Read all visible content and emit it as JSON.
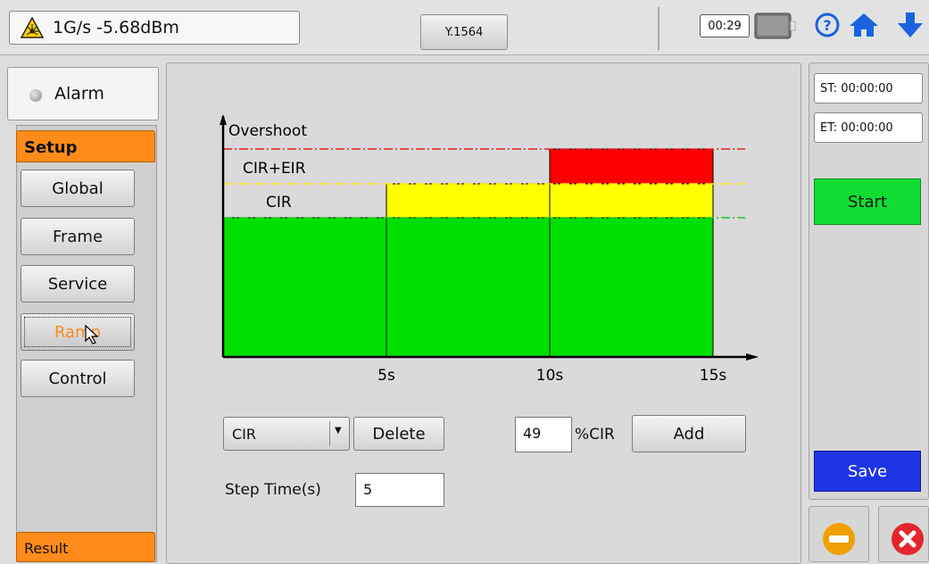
{
  "status": {
    "signal_text": "1G/s -5.68dBm",
    "mode_label": "Y.1564",
    "timer": "00:29"
  },
  "sidebar": {
    "alarm_label": "Alarm",
    "section_header": "Setup",
    "items": [
      {
        "label": "Global"
      },
      {
        "label": "Frame"
      },
      {
        "label": "Service"
      },
      {
        "label": "Ramp"
      },
      {
        "label": "Control"
      }
    ],
    "result_label": "Result"
  },
  "chart_data": {
    "type": "bar",
    "categories": [
      "0-5s",
      "5-10s",
      "10-15s"
    ],
    "x_ticks": [
      "5s",
      "10s",
      "15s"
    ],
    "series": [
      {
        "name": "CIR",
        "values": [
          1,
          1,
          1
        ]
      },
      {
        "name": "CIR+EIR",
        "values": [
          0,
          1,
          1
        ]
      },
      {
        "name": "Overshoot",
        "values": [
          0,
          0,
          1
        ]
      }
    ],
    "level_labels": [
      "Overshoot",
      "CIR+EIR",
      "CIR"
    ],
    "colors": {
      "cir": "#00e000",
      "cir_eir": "#ffff00",
      "overshoot": "#ff0000"
    }
  },
  "controls": {
    "step_type_selected": "CIR",
    "delete_label": "Delete",
    "percent_value": "49",
    "percent_unit": "%CIR",
    "add_label": "Add",
    "step_time_label": "Step Time(s)",
    "step_time_value": "5"
  },
  "right": {
    "st_text": "ST: 00:00:00",
    "et_text": "ET: 00:00:00",
    "start_label": "Start",
    "save_label": "Save"
  }
}
